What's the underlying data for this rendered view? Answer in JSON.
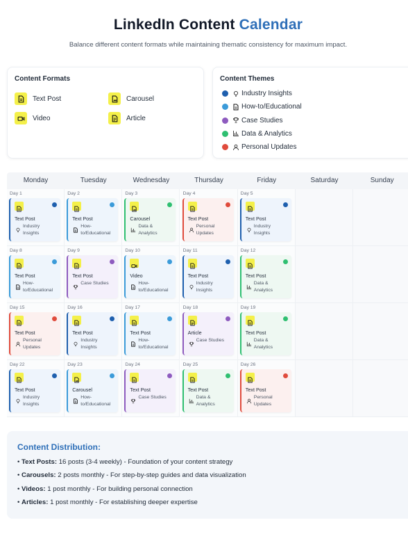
{
  "header": {
    "title_main": "LinkedIn Content",
    "title_accent": "Calendar",
    "subtitle": "Balance different content formats while maintaining thematic consistency for maximum impact."
  },
  "formats": {
    "heading": "Content Formats",
    "items": [
      {
        "label": "Text Post",
        "icon": "document-icon"
      },
      {
        "label": "Carousel",
        "icon": "carousel-icon"
      },
      {
        "label": "Video",
        "icon": "video-icon"
      },
      {
        "label": "Article",
        "icon": "article-icon"
      }
    ]
  },
  "themes": {
    "heading": "Content Themes",
    "items": [
      {
        "label": "Industry Insights",
        "color": "#1e5fae",
        "icon": "lightbulb-icon"
      },
      {
        "label": "How-to/Educational",
        "color": "#3b9bd9",
        "icon": "document-icon"
      },
      {
        "label": "Case Studies",
        "color": "#8e5bbf",
        "icon": "trophy-icon"
      },
      {
        "label": "Data & Analytics",
        "color": "#2fbf71",
        "icon": "bar-chart-icon"
      },
      {
        "label": "Personal Updates",
        "color": "#e04b3c",
        "icon": "person-icon"
      }
    ]
  },
  "calendar": {
    "days": [
      "Monday",
      "Tuesday",
      "Wednesday",
      "Thursday",
      "Friday",
      "Saturday",
      "Sunday"
    ],
    "weeks": [
      [
        {
          "day": "Day 1",
          "type": "Text Post",
          "theme": "Industry Insights",
          "theme_lines": [
            "Industry",
            "Insights"
          ]
        },
        {
          "day": "Day 2",
          "type": "Text Post",
          "theme": "How-to/Educational",
          "theme_lines": [
            "How-",
            "to/Educational"
          ]
        },
        {
          "day": "Day 3",
          "type": "Carousel",
          "theme": "Data & Analytics",
          "theme_lines": [
            "Data &",
            "Analytics"
          ]
        },
        {
          "day": "Day 4",
          "type": "Text Post",
          "theme": "Personal Updates",
          "theme_lines": [
            "Personal",
            "Updates"
          ]
        },
        {
          "day": "Day 5",
          "type": "Text Post",
          "theme": "Industry Insights",
          "theme_lines": [
            "Industry",
            "Insights"
          ]
        }
      ],
      [
        {
          "day": "Day 8",
          "type": "Text Post",
          "theme": "How-to/Educational",
          "theme_lines": [
            "How-",
            "to/Educational"
          ]
        },
        {
          "day": "Day 9",
          "type": "Text Post",
          "theme": "Case Studies",
          "theme_lines": [
            "Case Studies",
            ""
          ]
        },
        {
          "day": "Day 10",
          "type": "Video",
          "theme": "How-to/Educational",
          "theme_lines": [
            "How-",
            "to/Educational"
          ]
        },
        {
          "day": "Day 11",
          "type": "Text Post",
          "theme": "Industry Insights",
          "theme_lines": [
            "Industry",
            "Insights"
          ]
        },
        {
          "day": "Day 12",
          "type": "Text Post",
          "theme": "Data & Analytics",
          "theme_lines": [
            "Data &",
            "Analytics"
          ]
        }
      ],
      [
        {
          "day": "Day 15",
          "type": "Text Post",
          "theme": "Personal Updates",
          "theme_lines": [
            "Personal",
            "Updates"
          ]
        },
        {
          "day": "Day 16",
          "type": "Text Post",
          "theme": "Industry Insights",
          "theme_lines": [
            "Industry",
            "Insights"
          ]
        },
        {
          "day": "Day 17",
          "type": "Text Post",
          "theme": "How-to/Educational",
          "theme_lines": [
            "How-",
            "to/Educational"
          ]
        },
        {
          "day": "Day 18",
          "type": "Article",
          "theme": "Case Studies",
          "theme_lines": [
            "Case Studies",
            ""
          ]
        },
        {
          "day": "Day 19",
          "type": "Text Post",
          "theme": "Data & Analytics",
          "theme_lines": [
            "Data &",
            "Analytics"
          ]
        }
      ],
      [
        {
          "day": "Day 22",
          "type": "Text Post",
          "theme": "Industry Insights",
          "theme_lines": [
            "Industry",
            "Insights"
          ]
        },
        {
          "day": "Day 23",
          "type": "Carousel",
          "theme": "How-to/Educational",
          "theme_lines": [
            "How-",
            "to/Educational"
          ]
        },
        {
          "day": "Day 24",
          "type": "Text Post",
          "theme": "Case Studies",
          "theme_lines": [
            "Case Studies",
            ""
          ]
        },
        {
          "day": "Day 25",
          "type": "Text Post",
          "theme": "Data & Analytics",
          "theme_lines": [
            "Data &",
            "Analytics"
          ]
        },
        {
          "day": "Day 26",
          "type": "Text Post",
          "theme": "Personal Updates",
          "theme_lines": [
            "Personal",
            "Updates"
          ]
        }
      ]
    ]
  },
  "distribution": {
    "heading": "Content Distribution:",
    "items": [
      {
        "label": "Text Posts:",
        "text": "16 posts (3-4 weekly) - Foundation of your content strategy"
      },
      {
        "label": "Carousels:",
        "text": "2 posts monthly - For step-by-step guides and data visualization"
      },
      {
        "label": "Videos:",
        "text": "1 post monthly - For building personal connection"
      },
      {
        "label": "Articles:",
        "text": "1 post monthly - For establishing deeper expertise"
      }
    ]
  }
}
